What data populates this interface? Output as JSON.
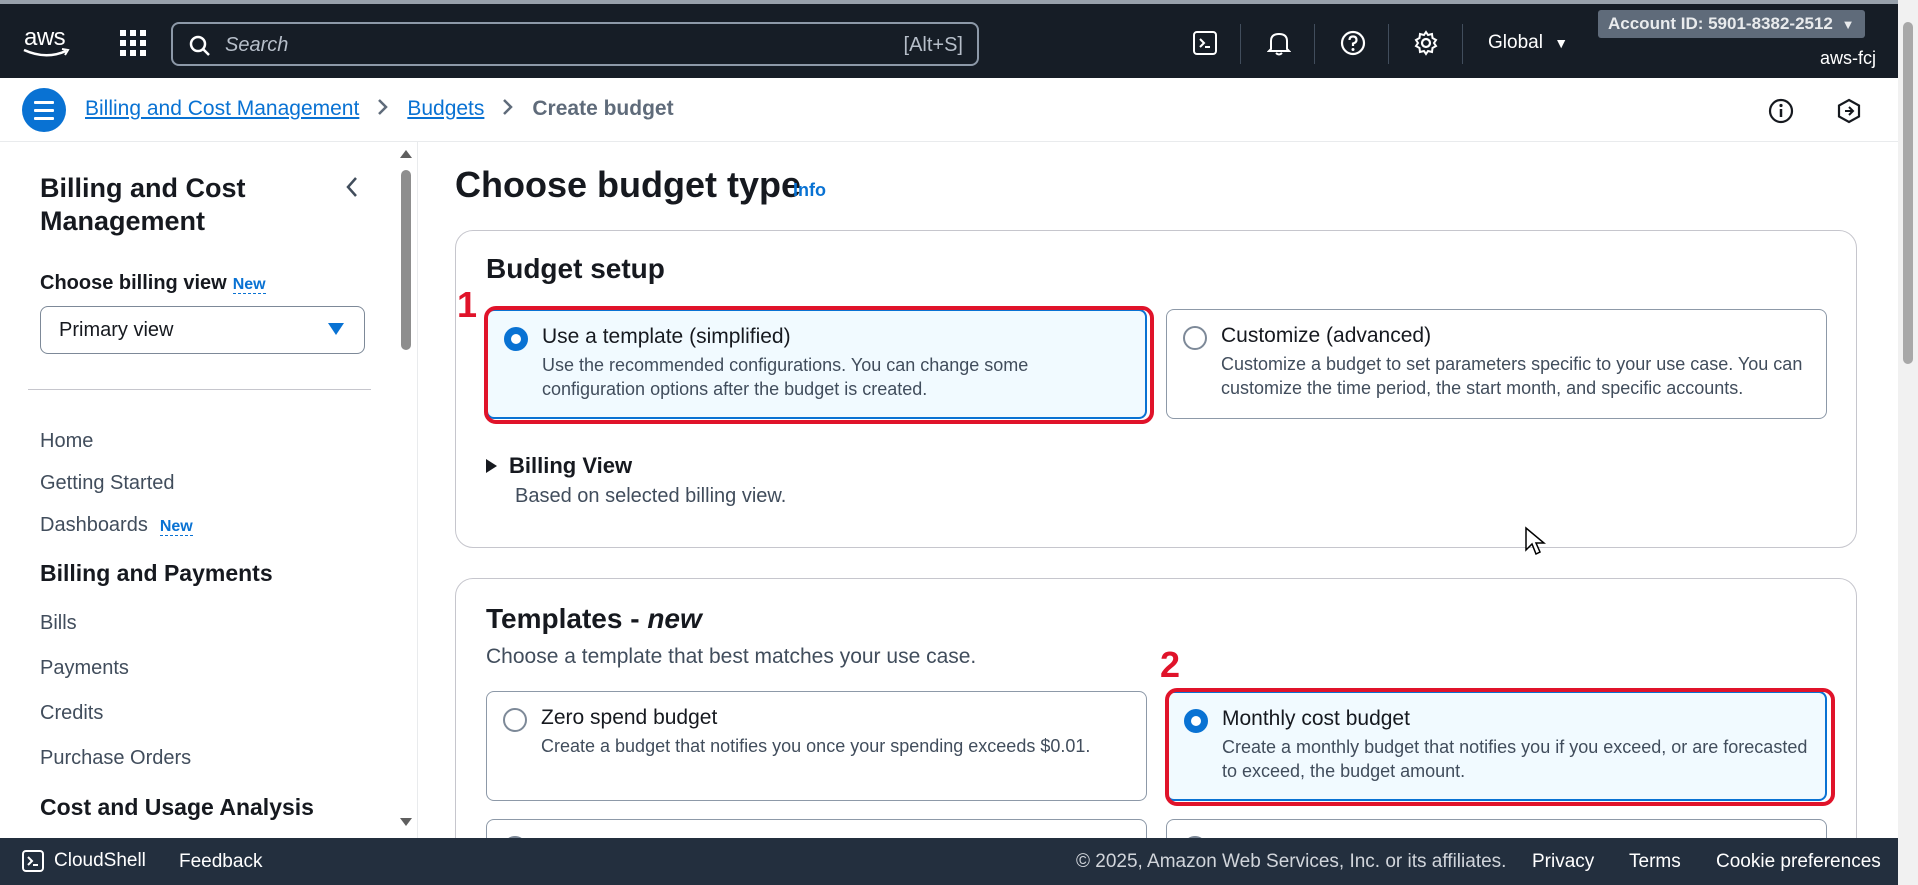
{
  "topnav": {
    "logo_text": "aws",
    "search_placeholder": "Search",
    "search_shortcut": "[Alt+S]",
    "region": "Global",
    "account": "Account ID: 5901-8382-2512",
    "user": "aws-fcj"
  },
  "breadcrumb": {
    "items": [
      "Billing and Cost Management",
      "Budgets"
    ],
    "current": "Create budget",
    "separator": ">"
  },
  "sidebar": {
    "title": "Billing and Cost Management",
    "billing_view_label": "Choose billing view",
    "new_badge": "New",
    "billing_view_value": "Primary view",
    "items": {
      "home": "Home",
      "getting_started": "Getting Started",
      "dashboards": "Dashboards"
    },
    "sections": {
      "billing_payments": "Billing and Payments",
      "cost_usage": "Cost and Usage Analysis"
    },
    "billing_items": [
      "Bills",
      "Payments",
      "Credits",
      "Purchase Orders"
    ]
  },
  "main": {
    "title": "Choose budget type",
    "info": "Info",
    "setup": {
      "title": "Budget setup",
      "template_option": {
        "title": "Use a template (simplified)",
        "desc": "Use the recommended configurations. You can change some configuration options after the budget is created.",
        "selected": true
      },
      "custom_option": {
        "title": "Customize (advanced)",
        "desc": "Customize a budget to set parameters specific to your use case. You can customize the time period, the start month, and specific accounts.",
        "selected": false
      },
      "billing_view_title": "Billing View",
      "billing_view_desc": "Based on selected billing view."
    },
    "templates": {
      "title": "Templates - ",
      "title_em": "new",
      "subtitle": "Choose a template that best matches your use case.",
      "zero_spend": {
        "title": "Zero spend budget",
        "desc": "Create a budget that notifies you once your spending exceeds $0.01.",
        "selected": false
      },
      "monthly_cost": {
        "title": "Monthly cost budget",
        "desc": "Create a monthly budget that notifies you if you exceed, or are forecasted to exceed, the budget amount.",
        "selected": true
      }
    },
    "annotations": [
      "1",
      "2"
    ]
  },
  "footer": {
    "cloudshell": "CloudShell",
    "feedback": "Feedback",
    "copyright": "© 2025, Amazon Web Services, Inc. or its affiliates.",
    "privacy": "Privacy",
    "terms": "Terms",
    "cookies": "Cookie preferences"
  },
  "colors": {
    "nav_bg": "#161d26",
    "accent": "#0972d3",
    "highlight": "#e0132a",
    "footer_bg": "#232f3e"
  }
}
